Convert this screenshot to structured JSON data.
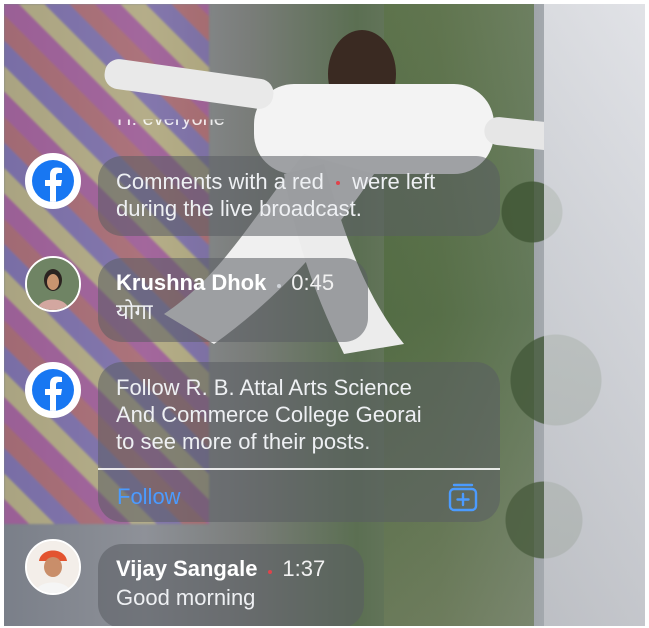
{
  "partial_top_text": "H: everyone",
  "notice": {
    "icon": "facebook-icon",
    "text_before": "Comments with a red",
    "text_after": "were left",
    "line2": "during the live broadcast."
  },
  "comments": [
    {
      "name": "Krushna Dhok",
      "time": "0:45",
      "text": "योगा",
      "avatar": "avatar-krushna"
    },
    {
      "name": "Vijay Sangale",
      "time": "1:37",
      "text": "Good morning",
      "avatar": "avatar-vijay"
    }
  ],
  "follow_card": {
    "icon": "facebook-icon",
    "line1": "Follow R. B. Attal  Arts Science",
    "line2": "And Commerce College Georai",
    "line3": "to see more of their posts.",
    "action_label": "Follow",
    "action_icon": "add-to-collection-icon"
  },
  "colors": {
    "accent": "#1877f2",
    "link": "#4b9bff",
    "live_dot": "#e0434b"
  }
}
